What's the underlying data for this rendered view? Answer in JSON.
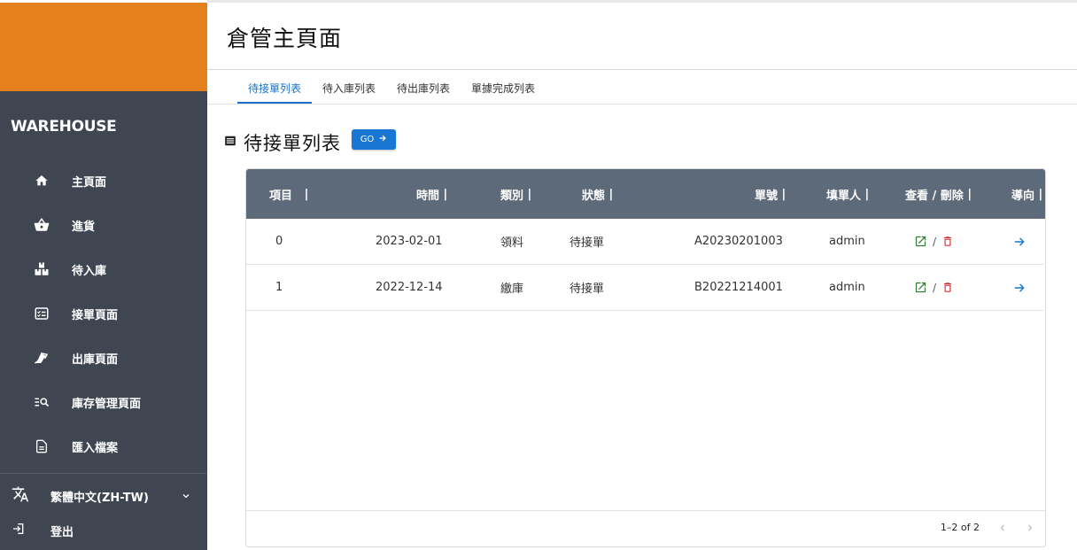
{
  "sidebar": {
    "brand": "WAREHOUSE",
    "items": [
      {
        "label": "主頁面",
        "icon": "home-icon"
      },
      {
        "label": "進貨",
        "icon": "basket-icon"
      },
      {
        "label": "待入庫",
        "icon": "boxes-icon"
      },
      {
        "label": "接單頁面",
        "icon": "checklist-icon"
      },
      {
        "label": "出庫頁面",
        "icon": "shipping-icon"
      },
      {
        "label": "庫存管理頁面",
        "icon": "manage-search-icon"
      },
      {
        "label": "匯入檔案",
        "icon": "file-icon"
      }
    ],
    "language": "繁體中文(ZH-TW)",
    "logout": "登出"
  },
  "header": {
    "title": "倉管主頁面"
  },
  "tabs": [
    "待接單列表",
    "待入庫列表",
    "待出庫列表",
    "單據完成列表"
  ],
  "section": {
    "title": "待接單列表",
    "go_label": "GO"
  },
  "table": {
    "columns": [
      "項目",
      "時間",
      "類別",
      "狀態",
      "單號",
      "填單人",
      "查看 / 刪除",
      "導向"
    ],
    "rows": [
      {
        "index": "0",
        "time": "2023-02-01",
        "category": "領料",
        "status": "待接單",
        "order_no": "A20230201003",
        "creator": "admin"
      },
      {
        "index": "1",
        "time": "2022-12-14",
        "category": "繳庫",
        "status": "待接單",
        "order_no": "B20221214001",
        "creator": "admin"
      }
    ],
    "pagination": "1–2 of 2",
    "separator": "/"
  },
  "colors": {
    "brand": "#e5801f",
    "sidebar": "#3f4651",
    "header": "#5c6a7a",
    "accent": "#1976d2",
    "edit": "#2e7d32",
    "delete": "#d32f2f"
  }
}
